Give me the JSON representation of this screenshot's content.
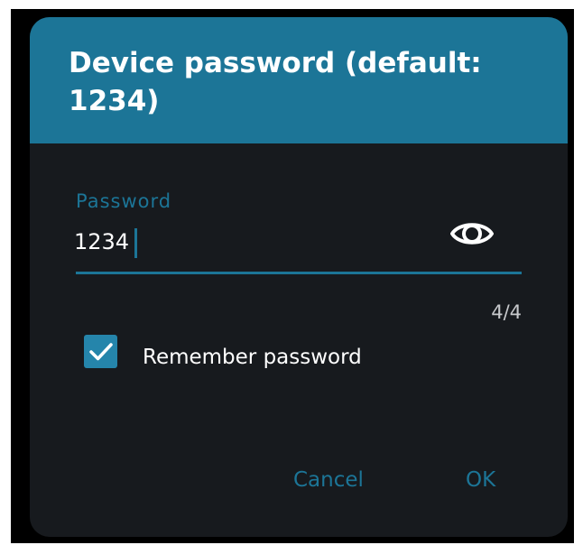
{
  "dialog": {
    "title": "Device password (default: 1234)",
    "password_field": {
      "label": "Password",
      "value": "1234",
      "counter": "4/4",
      "visibility_icon": "eye-icon"
    },
    "remember": {
      "label": "Remember password",
      "checked": true,
      "icon": "checkmark-icon"
    },
    "actions": {
      "cancel_label": "Cancel",
      "ok_label": "OK"
    }
  },
  "colors": {
    "accent": "#1c7597",
    "dialog_background": "#171a1e",
    "backdrop": "#000000",
    "text": "#ffffff"
  }
}
